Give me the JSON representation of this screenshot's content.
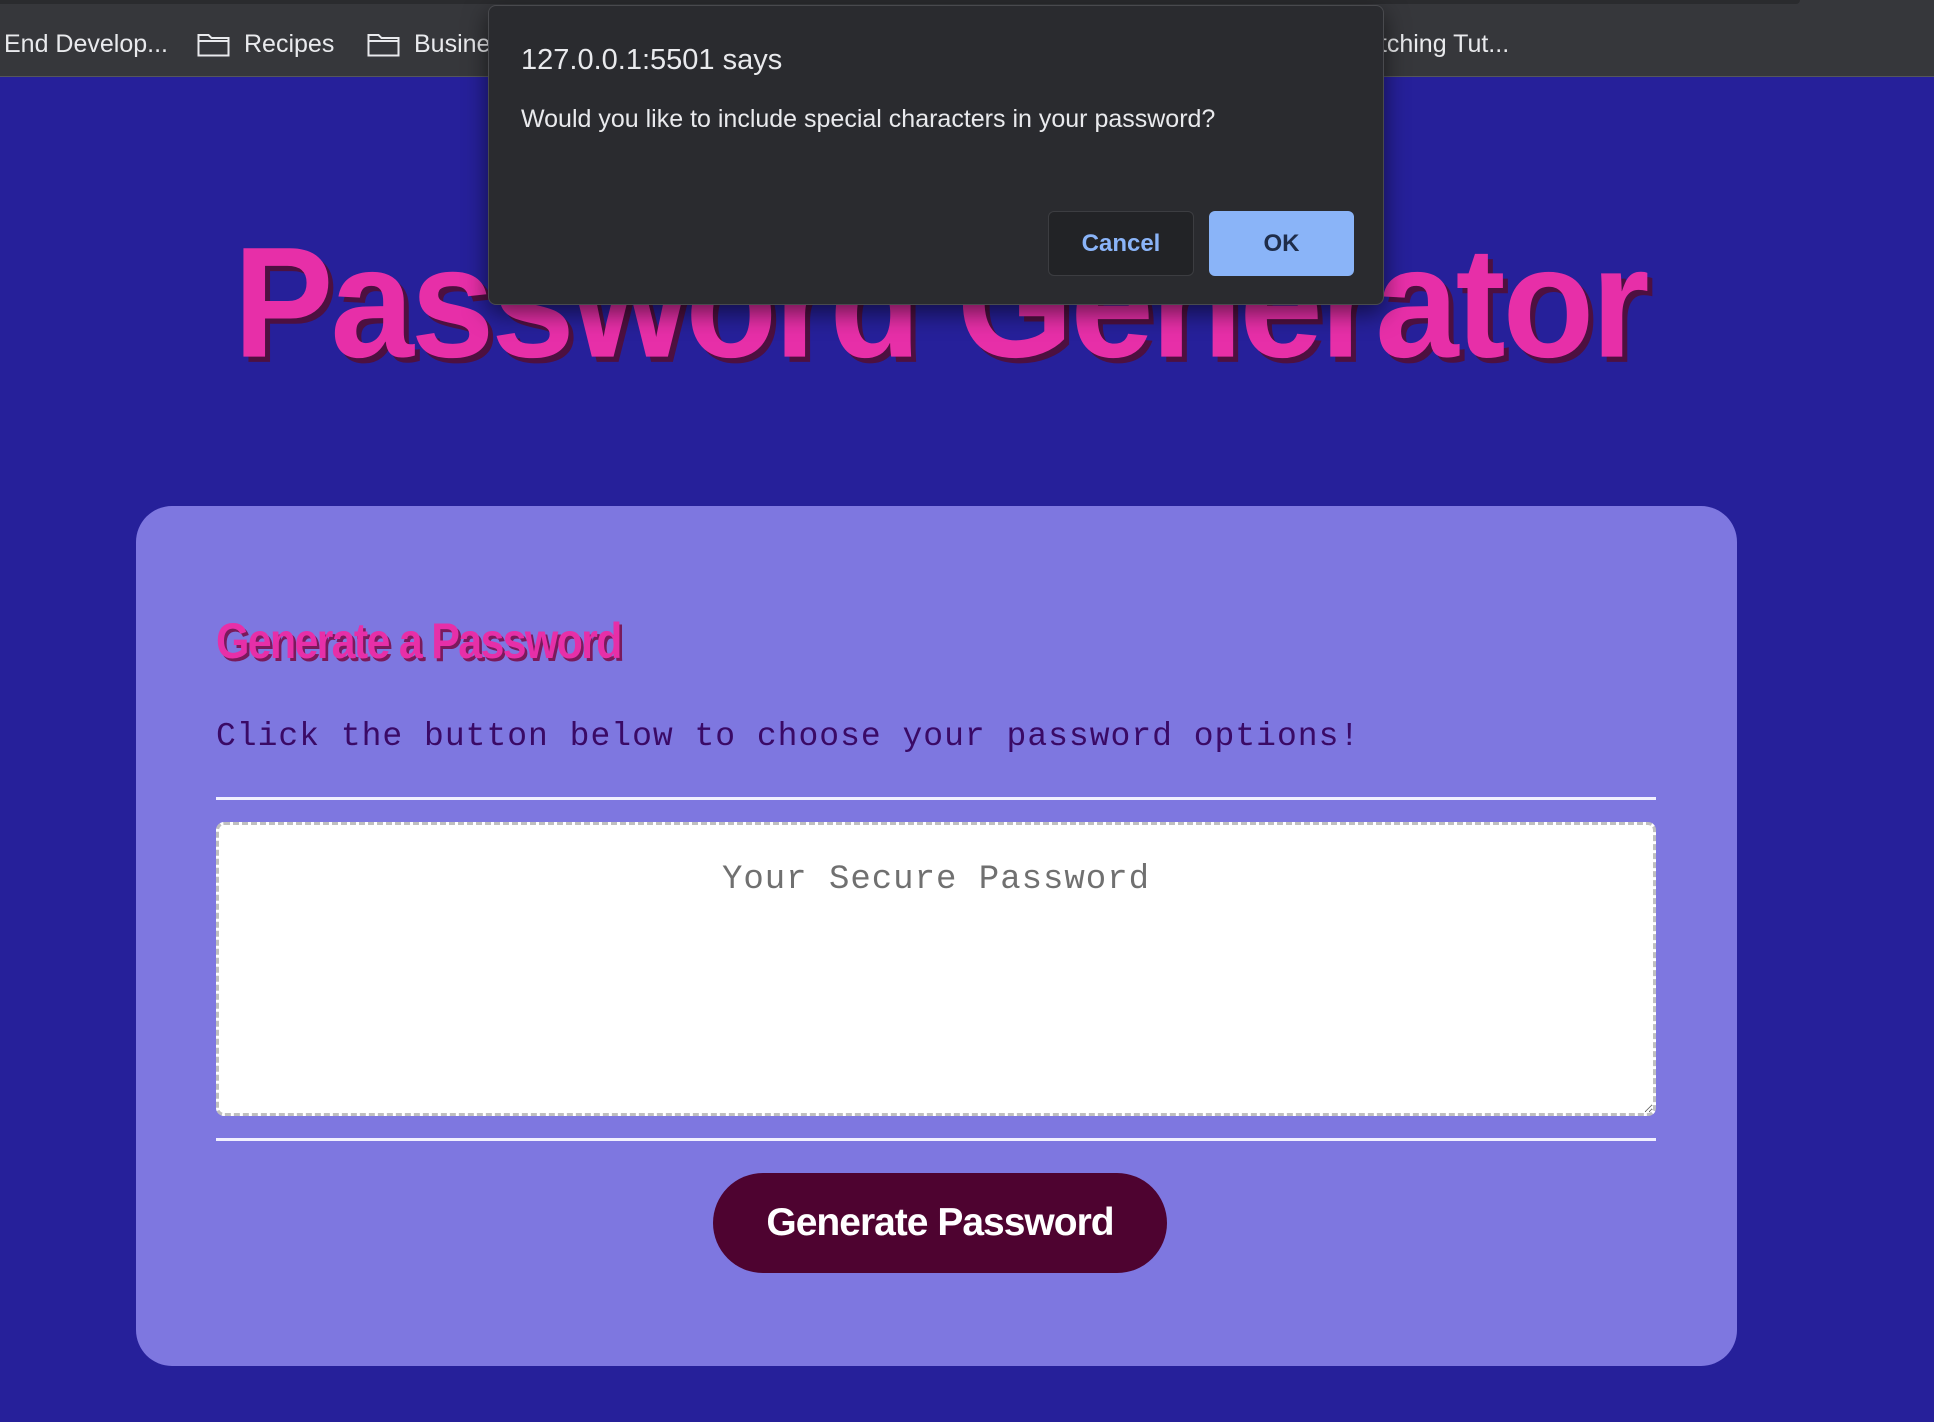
{
  "bookmarks": [
    {
      "label": "End Develop...",
      "icon": "none"
    },
    {
      "label": "Recipes",
      "icon": "folder-icon"
    },
    {
      "label": "Busine",
      "icon": "folder-icon"
    },
    {
      "label": "atching Tut...",
      "icon": "none"
    }
  ],
  "page": {
    "title": "Password Generator"
  },
  "card": {
    "header": "Generate a Password",
    "subtitle": "Click the button below to choose your password options!",
    "password_placeholder": "Your Secure Password",
    "generate_button_label": "Generate Password"
  },
  "dialog": {
    "title": "127.0.0.1:5501 says",
    "message": "Would you like to include special characters in your password?",
    "cancel_label": "Cancel",
    "ok_label": "OK"
  },
  "colors": {
    "page_background": "#26209a",
    "card_background": "#7e77e0",
    "title_pink": "#e72fa8",
    "button_maroon": "#4e0330",
    "dialog_accent": "#8ab4f8"
  }
}
